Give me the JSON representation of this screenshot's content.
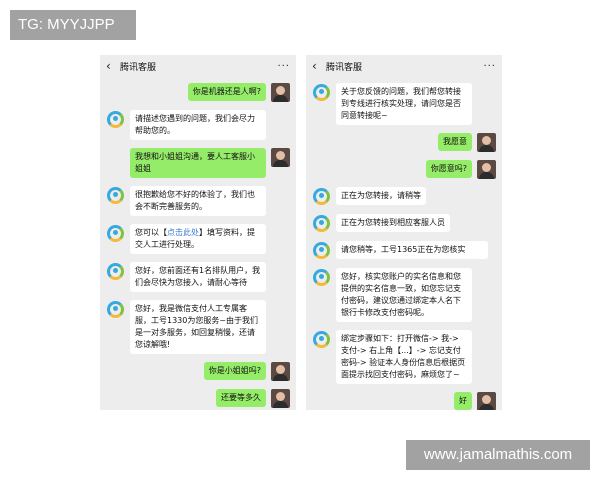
{
  "watermark_top": "TG: MYYJJPP",
  "watermark_bottom": "www.jamalmathis.com",
  "left_chat": {
    "title": "腾讯客服",
    "back_icon": "‹",
    "more_icon": "···",
    "messages": [
      {
        "from": "user",
        "text": "你是机器还是人啊?"
      },
      {
        "from": "bot",
        "text": "请描述您遇到的问题，我们会尽力帮助您的。"
      },
      {
        "from": "user",
        "text": "我想和小姐姐沟通，要人工客服小姐姐"
      },
      {
        "from": "bot",
        "text": "很抱歉给您不好的体验了，我们也会不断完善服务的。"
      },
      {
        "from": "bot",
        "text_before": "您可以【",
        "link": "点击此处",
        "text_after": "】填写资料，提交人工进行处理。"
      },
      {
        "from": "bot",
        "text": "您好，您前面还有1名排队用户，我们会尽快为您接入，请耐心等待"
      },
      {
        "from": "bot",
        "text": "您好，我是微信支付人工专属客服，工号1330为您服务~由于我们是一对多服务，如回复稍慢，还请您谅解哦!"
      },
      {
        "from": "user",
        "text": "你是小姐姐吗?"
      },
      {
        "from": "user",
        "text": "还要等多久"
      }
    ]
  },
  "right_chat": {
    "title": "腾讯客服",
    "back_icon": "‹",
    "more_icon": "···",
    "messages": [
      {
        "from": "bot",
        "text": "关于您反馈的问题，我们帮您转接到专线进行核实处理，请问您是否同意转接呢~"
      },
      {
        "from": "user",
        "text": "我愿意"
      },
      {
        "from": "user",
        "text": "你愿意吗?"
      },
      {
        "from": "bot",
        "text": "正在为您转接，请稍等"
      },
      {
        "from": "bot",
        "text": "正在为您转接到相应客服人员"
      },
      {
        "from": "bot",
        "text": "请您稍等，工号1365正在为您核实"
      },
      {
        "from": "bot",
        "text": "您好，核实您账户的实名信息和您提供的实名信息一致，如您忘记支付密码，建议您通过绑定本人名下银行卡修改支付密码呢。"
      },
      {
        "from": "bot",
        "text": "绑定步骤如下：打开微信-> 我-> 支付-> 右上角【...】-> 忘记支付密码-> 验证本人身份信息后根据页面提示找回支付密码，麻烦您了~"
      },
      {
        "from": "user",
        "text": "好"
      }
    ]
  }
}
